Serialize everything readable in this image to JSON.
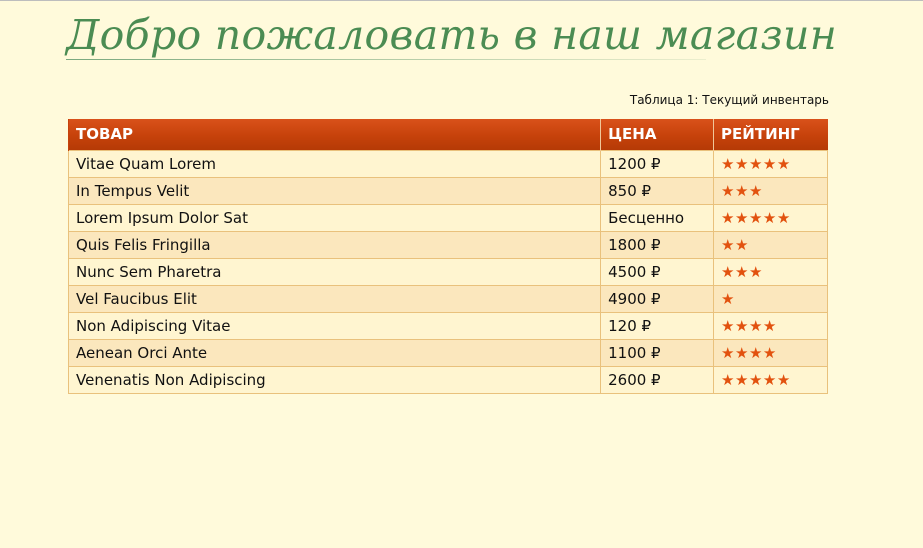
{
  "page": {
    "title": "Добро пожаловать в наш магазин",
    "caption": "Таблица 1: Текущий инвентарь"
  },
  "colors": {
    "background": "#fffadb",
    "title": "#4b8c53",
    "header": "#c6420b",
    "row_odd": "#fff5d0",
    "row_even": "#fbe7bd",
    "star": "#e2520f"
  },
  "table": {
    "headers": {
      "name": "ТОВАР",
      "price": "ЦЕНА",
      "rating": "РЕЙТИНГ"
    },
    "rows": [
      {
        "name": "Vitae Quam Lorem",
        "price": "1200 ₽",
        "rating": 5,
        "stars": "★★★★★"
      },
      {
        "name": "In Tempus Velit",
        "price": "850 ₽",
        "rating": 3,
        "stars": "★★★"
      },
      {
        "name": "Lorem Ipsum Dolor Sat",
        "price": "Бесценно",
        "rating": 5,
        "stars": "★★★★★"
      },
      {
        "name": "Quis Felis Fringilla",
        "price": "1800 ₽",
        "rating": 2,
        "stars": "★★"
      },
      {
        "name": "Nunc Sem Pharetra",
        "price": "4500 ₽",
        "rating": 3,
        "stars": "★★★"
      },
      {
        "name": "Vel Faucibus Elit",
        "price": "4900 ₽",
        "rating": 1,
        "stars": "★"
      },
      {
        "name": "Non Adipiscing Vitae",
        "price": "120 ₽",
        "rating": 4,
        "stars": "★★★★"
      },
      {
        "name": "Aenean Orci Ante",
        "price": "1100 ₽",
        "rating": 4,
        "stars": "★★★★"
      },
      {
        "name": "Venenatis Non Adipiscing",
        "price": "2600 ₽",
        "rating": 5,
        "stars": "★★★★★"
      }
    ]
  }
}
